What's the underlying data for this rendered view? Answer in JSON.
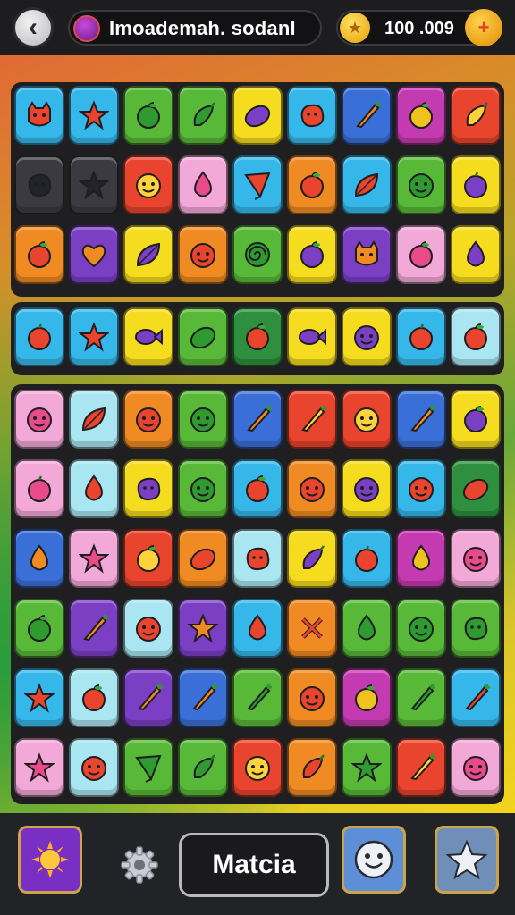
{
  "header": {
    "back_icon": "back-arrow-icon",
    "title": "Imoademah. sodanl",
    "coins": "100 .009",
    "coin_icon": "coin-icon",
    "add_icon": "add-coins-icon"
  },
  "board": {
    "palette": {
      "cyan": "#36b7ea",
      "red": "#e8442e",
      "green": "#58b838",
      "yellow": "#f6dc1e",
      "orange": "#f08a22",
      "purple": "#7b3fc4",
      "pink": "#f2a9d8",
      "dark": "#3a3a40",
      "lightcyan": "#a9e6f2",
      "darkgreen": "#2e8f3e",
      "magenta": "#c43ab0",
      "blue": "#3a6fd8"
    },
    "sections": [
      {
        "name": "top-block",
        "rows": [
          [
            [
              "cyan",
              "cat"
            ],
            [
              "cyan",
              "star"
            ],
            [
              "green",
              "apple"
            ],
            [
              "green",
              "pepper"
            ],
            [
              "yellow",
              "lemon"
            ],
            [
              "cyan",
              "blob"
            ],
            [
              "blue",
              "carrot"
            ],
            [
              "magenta",
              "apple"
            ],
            [
              "red",
              "pepper"
            ]
          ],
          [
            [
              "dark",
              "blob"
            ],
            [
              "dark",
              "star"
            ],
            [
              "red",
              "face"
            ],
            [
              "pink",
              "drop"
            ],
            [
              "cyan",
              "kite"
            ],
            [
              "orange",
              "apple"
            ],
            [
              "cyan",
              "leaf"
            ],
            [
              "green",
              "face"
            ],
            [
              "yellow",
              "plum"
            ]
          ],
          [
            [
              "orange",
              "apple"
            ],
            [
              "purple",
              "heart"
            ],
            [
              "yellow",
              "leaf"
            ],
            [
              "orange",
              "face"
            ],
            [
              "green",
              "swirl"
            ],
            [
              "yellow",
              "apple"
            ],
            [
              "purple",
              "cat"
            ],
            [
              "pink",
              "apple"
            ],
            [
              "yellow",
              "drop"
            ]
          ]
        ]
      },
      {
        "name": "middle-strip",
        "rows": [
          [
            [
              "cyan",
              "plum"
            ],
            [
              "cyan",
              "star"
            ],
            [
              "yellow",
              "fish"
            ],
            [
              "green",
              "lemon"
            ],
            [
              "darkgreen",
              "apple"
            ],
            [
              "yellow",
              "fish"
            ],
            [
              "yellow",
              "face"
            ],
            [
              "cyan",
              "plum"
            ],
            [
              "lightcyan",
              "apple"
            ]
          ]
        ]
      },
      {
        "name": "lower-block",
        "rows": [
          [
            [
              "pink",
              "face"
            ],
            [
              "lightcyan",
              "leaf"
            ],
            [
              "orange",
              "face"
            ],
            [
              "green",
              "face"
            ],
            [
              "blue",
              "carrot"
            ],
            [
              "red",
              "carrot"
            ],
            [
              "red",
              "face"
            ],
            [
              "blue",
              "carrot"
            ],
            [
              "yellow",
              "apple"
            ]
          ],
          [
            [
              "pink",
              "plum"
            ],
            [
              "lightcyan",
              "drop"
            ],
            [
              "yellow",
              "blob"
            ],
            [
              "green",
              "face"
            ],
            [
              "cyan",
              "apple"
            ],
            [
              "orange",
              "face"
            ],
            [
              "yellow",
              "face"
            ],
            [
              "cyan",
              "face"
            ],
            [
              "darkgreen",
              "lemon"
            ]
          ],
          [
            [
              "blue",
              "drop"
            ],
            [
              "pink",
              "star"
            ],
            [
              "red",
              "apple"
            ],
            [
              "orange",
              "lemon"
            ],
            [
              "lightcyan",
              "blob"
            ],
            [
              "yellow",
              "pepper"
            ],
            [
              "cyan",
              "plum"
            ],
            [
              "magenta",
              "drop"
            ],
            [
              "pink",
              "face"
            ]
          ],
          [
            [
              "green",
              "apple"
            ],
            [
              "purple",
              "carrot"
            ],
            [
              "lightcyan",
              "face"
            ],
            [
              "purple",
              "star"
            ],
            [
              "cyan",
              "drop"
            ],
            [
              "orange",
              "fork"
            ],
            [
              "green",
              "drop"
            ],
            [
              "green",
              "face"
            ],
            [
              "green",
              "blob"
            ]
          ],
          [
            [
              "cyan",
              "star"
            ],
            [
              "lightcyan",
              "apple"
            ],
            [
              "purple",
              "carrot"
            ],
            [
              "blue",
              "carrot"
            ],
            [
              "green",
              "carrot"
            ],
            [
              "orange",
              "face"
            ],
            [
              "magenta",
              "apple"
            ],
            [
              "green",
              "carrot"
            ],
            [
              "cyan",
              "carrot"
            ]
          ],
          [
            [
              "pink",
              "star"
            ],
            [
              "lightcyan",
              "face"
            ],
            [
              "green",
              "kite"
            ],
            [
              "green",
              "pepper"
            ],
            [
              "red",
              "face"
            ],
            [
              "orange",
              "pepper"
            ],
            [
              "green",
              "star"
            ],
            [
              "red",
              "carrot"
            ],
            [
              "pink",
              "face"
            ]
          ]
        ]
      }
    ]
  },
  "footer": {
    "sun_icon": "sun-icon",
    "settings_icon": "gear-icon",
    "match_label": "Matcia",
    "face_icon": "smiley-face-icon",
    "star_icon": "star-icon"
  }
}
